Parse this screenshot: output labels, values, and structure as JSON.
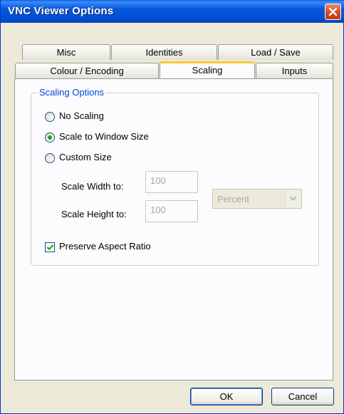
{
  "window": {
    "title": "VNC Viewer Options"
  },
  "tabs": {
    "row1": [
      "Misc",
      "Identities",
      "Load / Save"
    ],
    "row2": [
      "Colour / Encoding",
      "Scaling",
      "Inputs"
    ],
    "active": "Scaling"
  },
  "scaling": {
    "group_title": "Scaling Options",
    "options": [
      {
        "label": "No Scaling",
        "checked": false
      },
      {
        "label": "Scale to Window Size",
        "checked": true
      },
      {
        "label": "Custom Size",
        "checked": false
      }
    ],
    "width_label": "Scale Width to:",
    "width_value": "100",
    "height_label": "Scale Height to:",
    "height_value": "100",
    "unit_value": "Percent",
    "preserve_label": "Preserve Aspect Ratio",
    "preserve_checked": true
  },
  "buttons": {
    "ok": "OK",
    "cancel": "Cancel"
  },
  "icons": {
    "close": "close-icon",
    "dropdown": "chevron-down-icon",
    "check": "checkmark-icon"
  },
  "colors": {
    "titlebar": "#0855dd",
    "close": "#d2451c",
    "active_tab_accent": "#ffc83c",
    "group_title": "#0046d5",
    "radio_dot": "#21a121",
    "checkmark": "#21a121",
    "face": "#ece9d8"
  }
}
